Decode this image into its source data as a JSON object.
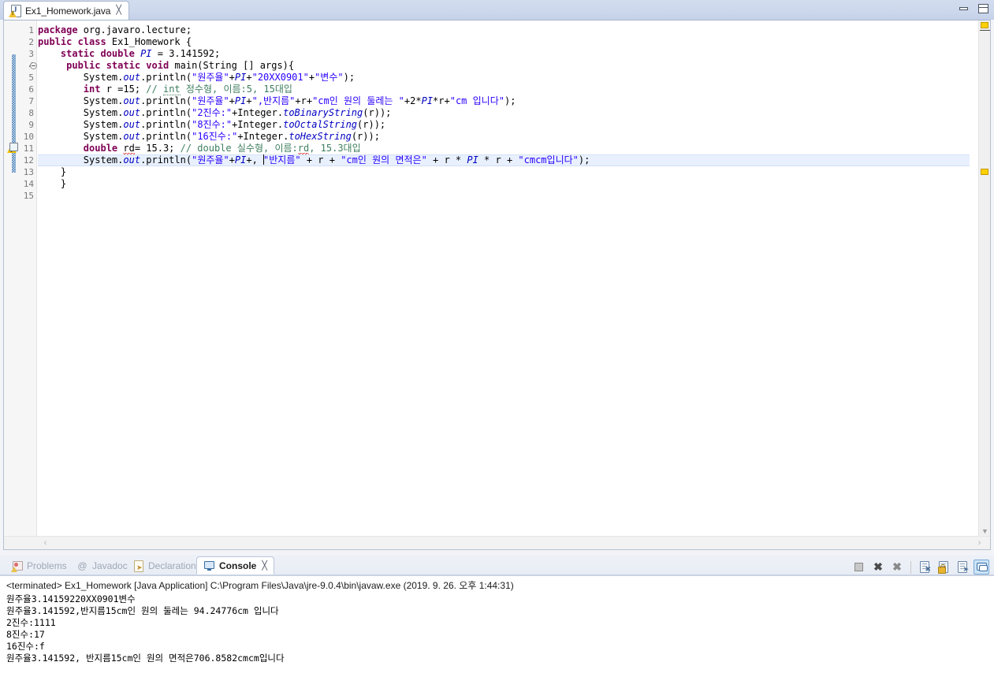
{
  "window": {
    "minimize_label": "Minimize",
    "maximize_label": "Maximize"
  },
  "editor": {
    "tab": {
      "title": "Ex1_Homework.java",
      "close_glyph": "╳",
      "icon": "java-file-warning-icon"
    },
    "line_numbers": [
      "1",
      "2",
      "3",
      "4",
      "5",
      "6",
      "7",
      "8",
      "9",
      "10",
      "11",
      "12",
      "13",
      "14",
      "15"
    ],
    "current_line": 12,
    "warning_line": 11,
    "folding_line": 4,
    "code_lines": [
      {
        "n": 1,
        "segments": [
          {
            "t": "package ",
            "c": "kw"
          },
          {
            "t": "org.javaro.lecture;",
            "c": ""
          }
        ]
      },
      {
        "n": 2,
        "segments": [
          {
            "t": "public class ",
            "c": "kw"
          },
          {
            "t": "Ex1_Homework {",
            "c": ""
          }
        ]
      },
      {
        "n": 3,
        "segments": [
          {
            "t": "    ",
            "c": ""
          },
          {
            "t": "static double ",
            "c": "kw"
          },
          {
            "t": "PI",
            "c": "fld"
          },
          {
            "t": " = 3.141592;",
            "c": ""
          }
        ]
      },
      {
        "n": 4,
        "segments": [
          {
            "t": "     ",
            "c": ""
          },
          {
            "t": "public static void ",
            "c": "kw"
          },
          {
            "t": "main(String [] args){",
            "c": ""
          }
        ]
      },
      {
        "n": 5,
        "segments": [
          {
            "t": "        System.",
            "c": ""
          },
          {
            "t": "out",
            "c": "stat"
          },
          {
            "t": ".println(",
            "c": ""
          },
          {
            "t": "\"원주율\"",
            "c": "str"
          },
          {
            "t": "+",
            "c": ""
          },
          {
            "t": "PI",
            "c": "fld"
          },
          {
            "t": "+",
            "c": ""
          },
          {
            "t": "\"20XX0901\"",
            "c": "str"
          },
          {
            "t": "+",
            "c": ""
          },
          {
            "t": "\"변수\"",
            "c": "str"
          },
          {
            "t": ");",
            "c": ""
          }
        ]
      },
      {
        "n": 6,
        "segments": [
          {
            "t": "        ",
            "c": ""
          },
          {
            "t": "int ",
            "c": "kw"
          },
          {
            "t": "r =15; ",
            "c": ""
          },
          {
            "t": "// ",
            "c": "cmt"
          },
          {
            "t": "int",
            "c": "cmt sq"
          },
          {
            "t": " 정수형, 이름:5, 15대입",
            "c": "cmt"
          }
        ]
      },
      {
        "n": 7,
        "segments": [
          {
            "t": "        System.",
            "c": ""
          },
          {
            "t": "out",
            "c": "stat"
          },
          {
            "t": ".println(",
            "c": ""
          },
          {
            "t": "\"원주율\"",
            "c": "str"
          },
          {
            "t": "+",
            "c": ""
          },
          {
            "t": "PI",
            "c": "fld"
          },
          {
            "t": "+",
            "c": ""
          },
          {
            "t": "\",반지름\"",
            "c": "str"
          },
          {
            "t": "+r+",
            "c": ""
          },
          {
            "t": "\"cm인 원의 둘레는 \"",
            "c": "str"
          },
          {
            "t": "+2*",
            "c": ""
          },
          {
            "t": "PI",
            "c": "fld"
          },
          {
            "t": "*r+",
            "c": ""
          },
          {
            "t": "\"cm 입니다\"",
            "c": "str"
          },
          {
            "t": ");",
            "c": ""
          }
        ]
      },
      {
        "n": 8,
        "segments": [
          {
            "t": "        System.",
            "c": ""
          },
          {
            "t": "out",
            "c": "stat"
          },
          {
            "t": ".println(",
            "c": ""
          },
          {
            "t": "\"2진수:\"",
            "c": "str"
          },
          {
            "t": "+Integer.",
            "c": ""
          },
          {
            "t": "toBinaryString",
            "c": "stat"
          },
          {
            "t": "(r));",
            "c": ""
          }
        ]
      },
      {
        "n": 9,
        "segments": [
          {
            "t": "        System.",
            "c": ""
          },
          {
            "t": "out",
            "c": "stat"
          },
          {
            "t": ".println(",
            "c": ""
          },
          {
            "t": "\"8진수:\"",
            "c": "str"
          },
          {
            "t": "+Integer.",
            "c": ""
          },
          {
            "t": "toOctalString",
            "c": "stat"
          },
          {
            "t": "(r));",
            "c": ""
          }
        ]
      },
      {
        "n": 10,
        "segments": [
          {
            "t": "        System.",
            "c": ""
          },
          {
            "t": "out",
            "c": "stat"
          },
          {
            "t": ".println(",
            "c": ""
          },
          {
            "t": "\"16진수:\"",
            "c": "str"
          },
          {
            "t": "+Integer.",
            "c": ""
          },
          {
            "t": "toHexString",
            "c": "stat"
          },
          {
            "t": "(r));",
            "c": ""
          }
        ]
      },
      {
        "n": 11,
        "segments": [
          {
            "t": "        ",
            "c": ""
          },
          {
            "t": "double ",
            "c": "kw"
          },
          {
            "t": "rd",
            "c": "sq-red"
          },
          {
            "t": "= 15.3; ",
            "c": ""
          },
          {
            "t": "// double 실수형, 이름:",
            "c": "cmt"
          },
          {
            "t": "rd",
            "c": "cmt sq-red"
          },
          {
            "t": ", 15.3대입",
            "c": "cmt"
          }
        ]
      },
      {
        "n": 12,
        "segments": [
          {
            "t": "        System.",
            "c": ""
          },
          {
            "t": "out",
            "c": "stat"
          },
          {
            "t": ".println(",
            "c": ""
          },
          {
            "t": "\"원주율\"",
            "c": "str"
          },
          {
            "t": "+",
            "c": ""
          },
          {
            "t": "PI",
            "c": "fld"
          },
          {
            "t": "+",
            "c": ""
          },
          {
            "t": ", ",
            "c": ""
          },
          {
            "t": "CARET",
            "c": "caret"
          },
          {
            "t": "\"반지름\"",
            "c": "str"
          },
          {
            "t": " + r + ",
            "c": ""
          },
          {
            "t": "\"cm인 원의 면적은\"",
            "c": "str"
          },
          {
            "t": " + r * ",
            "c": ""
          },
          {
            "t": "PI",
            "c": "fld"
          },
          {
            "t": " * r + ",
            "c": ""
          },
          {
            "t": "\"cmcm입니다\"",
            "c": "str"
          },
          {
            "t": ");",
            "c": ""
          }
        ]
      },
      {
        "n": 13,
        "segments": [
          {
            "t": "    }",
            "c": ""
          }
        ]
      },
      {
        "n": 14,
        "segments": [
          {
            "t": "    }",
            "c": ""
          }
        ]
      },
      {
        "n": 15,
        "segments": [
          {
            "t": "",
            "c": ""
          }
        ]
      }
    ],
    "hscroll": {
      "left_arrow": "‹",
      "right_arrow": "›"
    },
    "overview": {
      "up_arrow": "▲",
      "down_arrow": "▼",
      "markers": [
        2,
        188
      ]
    }
  },
  "bottom_panel": {
    "tabs": [
      {
        "label": "Problems",
        "icon": "problems-icon",
        "selected": false
      },
      {
        "label": "Javadoc",
        "icon": "javadoc-icon",
        "selected": false
      },
      {
        "label": "Declaration",
        "icon": "declaration-icon",
        "selected": false
      },
      {
        "label": "Console",
        "icon": "console-icon",
        "selected": true
      }
    ],
    "tab_close_glyph": "╳",
    "toolbar": [
      {
        "name": "terminate-button",
        "icon": "stop-icon"
      },
      {
        "name": "remove-launch-button",
        "icon": "x-icon"
      },
      {
        "name": "remove-all-launches-button",
        "icon": "xx-icon"
      },
      {
        "name": "clear-console-button",
        "icon": "clear-console-icon"
      },
      {
        "name": "scroll-lock-button",
        "icon": "lock-icon"
      },
      {
        "name": "pin-console-button",
        "icon": "pin-console-icon"
      },
      {
        "name": "display-selected-console-button",
        "icon": "open-console-icon"
      }
    ],
    "console": {
      "header": "<terminated> Ex1_Homework [Java Application] C:\\Program Files\\Java\\jre-9.0.4\\bin\\javaw.exe (2019. 9. 26. 오후 1:44:31)",
      "output": [
        "원주율3.14159220XX0901변수",
        "원주율3.141592,반지름15cm인 원의 둘레는 94.24776cm 입니다",
        "2진수:1111",
        "8진수:17",
        "16진수:f",
        "원주율3.141592, 반지름15cm인 원의 면적은706.8582cmcm입니다"
      ]
    }
  },
  "colors": {
    "keyword": "#7f0055",
    "string": "#2a00ff",
    "comment": "#3f7f5f",
    "field": "#0000c0",
    "current_line": "#e8f0fe",
    "tab_gradient_top": "#d3dcef",
    "warning": "#f0c000"
  }
}
